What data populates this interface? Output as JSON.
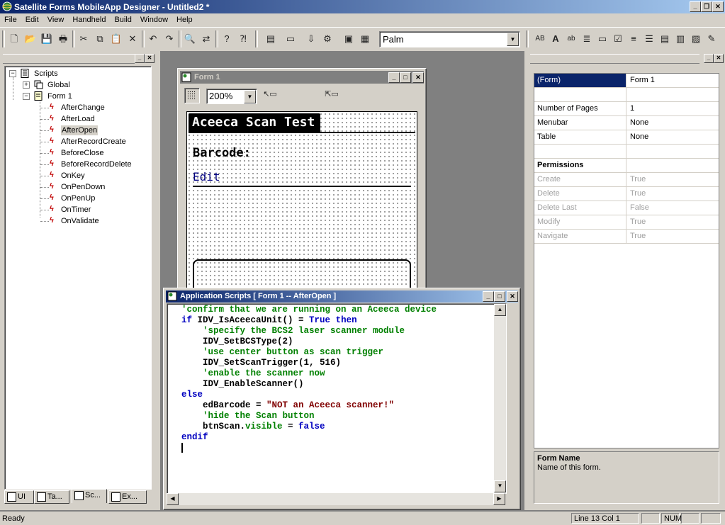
{
  "window": {
    "title": "Satellite Forms MobileApp Designer - Untitled2 *"
  },
  "menu": [
    "File",
    "Edit",
    "View",
    "Handheld",
    "Build",
    "Window",
    "Help"
  ],
  "toolbar": {
    "platform_value": "Palm"
  },
  "tree": {
    "root": "Scripts",
    "global": "Global",
    "form": "Form 1",
    "events": [
      "AfterChange",
      "AfterLoad",
      "AfterOpen",
      "AfterRecordCreate",
      "BeforeClose",
      "BeforeRecordDelete",
      "OnKey",
      "OnPenDown",
      "OnPenUp",
      "OnTimer",
      "OnValidate"
    ],
    "selected_event": "AfterOpen"
  },
  "left_tabs": [
    "UI",
    "Ta...",
    "Sc...",
    "Ex..."
  ],
  "form_window": {
    "title": "Form 1",
    "zoom": "200%",
    "form_title": "Aceeca Scan Test",
    "barcode_label": "Barcode:",
    "edit_label": "Edit"
  },
  "script_window": {
    "title": "Application Scripts [ Form 1 -- AfterOpen ]",
    "lines": [
      "'confirm that we are running on an Aceeca device",
      "if IDV_IsAceecaUnit() = True then",
      "    'specify the BCS2 laser scanner module",
      "    IDV_SetBCSType(2)",
      "    'use center button as scan trigger",
      "    IDV_SetScanTrigger(1, 516)",
      "    'enable the scanner now",
      "    IDV_EnableScanner()",
      "else",
      "    edBarcode = \"NOT an Aceeca scanner!\"",
      "    'hide the Scan button",
      "    btnScan.visible = false",
      "endif"
    ]
  },
  "properties": {
    "rows": [
      {
        "name": "(Form)",
        "value": "Form 1",
        "selected": true
      },
      {
        "name": "",
        "value": ""
      },
      {
        "name": "Number of Pages",
        "value": "1"
      },
      {
        "name": "Menubar",
        "value": "None"
      },
      {
        "name": "Table",
        "value": "None"
      },
      {
        "name": "",
        "value": ""
      },
      {
        "name": "Permissions",
        "value": "",
        "header": true
      },
      {
        "name": "Create",
        "value": "True",
        "disabled": true
      },
      {
        "name": "Delete",
        "value": "True",
        "disabled": true
      },
      {
        "name": "Delete Last",
        "value": "False",
        "disabled": true
      },
      {
        "name": "Modify",
        "value": "True",
        "disabled": true
      },
      {
        "name": "Navigate",
        "value": "True",
        "disabled": true
      }
    ],
    "description_title": "Form Name",
    "description_text": "Name of this form."
  },
  "status": {
    "message": "Ready",
    "position": "Line 13 Col 1",
    "num": "NUM"
  }
}
